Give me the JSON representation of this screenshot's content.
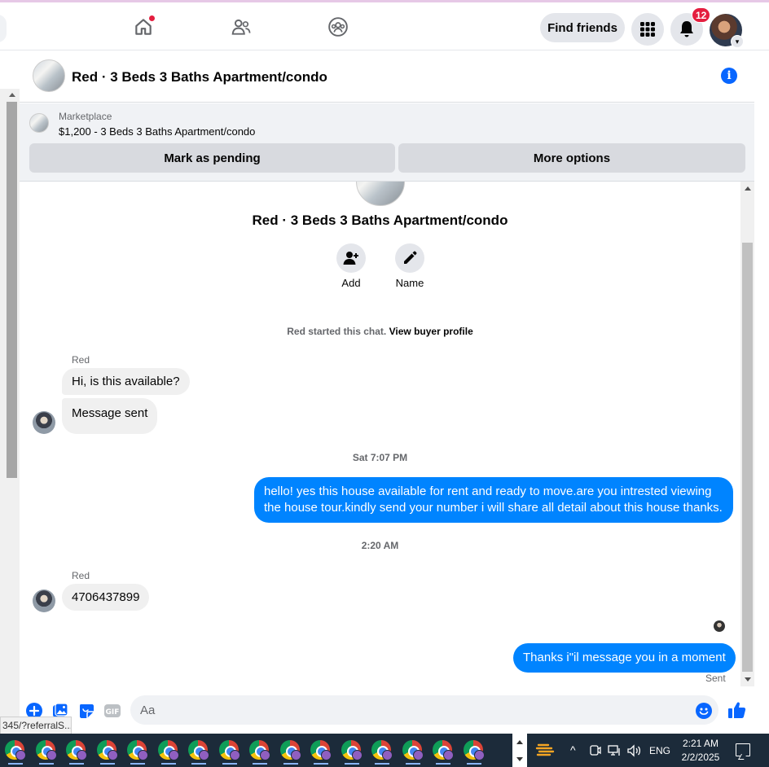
{
  "topnav": {
    "find_friends_label": "Find friends",
    "notification_count": "12"
  },
  "chat": {
    "title": "Red · 3 Beds 3 Baths Apartment/condo"
  },
  "marketplace": {
    "label": "Marketplace",
    "listing": "$1,200 - 3 Beds 3 Baths Apartment/condo",
    "mark_pending_label": "Mark as pending",
    "more_options_label": "More options"
  },
  "intro": {
    "title": "Red · 3 Beds 3 Baths Apartment/condo",
    "add_label": "Add",
    "name_label": "Name",
    "started_text": "Red started this chat.",
    "view_profile_link": "View buyer profile"
  },
  "messages": {
    "sender1_name": "Red",
    "msg1": "Hi, is this available?",
    "msg2": "Message sent",
    "time1": "Sat 7:07 PM",
    "out1": "hello! yes this house available for rent and ready to move.are you intrested viewing the house tour.kindly send your number i will share all detail about this house thanks.",
    "time2": "2:20 AM",
    "sender2_name": "Red",
    "msg3": "4706437899",
    "out2": "Thanks i\"il message you in a moment",
    "sent_status": "Sent"
  },
  "composer": {
    "placeholder": "Aa",
    "gif_label": "GIF"
  },
  "statusbar": {
    "url": "345/?referralS..."
  },
  "taskbar": {
    "language": "ENG",
    "time": "2:21 AM",
    "date": "2/2/2025",
    "chrome_count": 16
  },
  "colors": {
    "accent": "#0866ff",
    "outgoing_bubble": "#0084ff",
    "incoming_bubble": "#f0f0f0",
    "badge": "#e41e3f",
    "taskbar": "#1c2b3a"
  }
}
